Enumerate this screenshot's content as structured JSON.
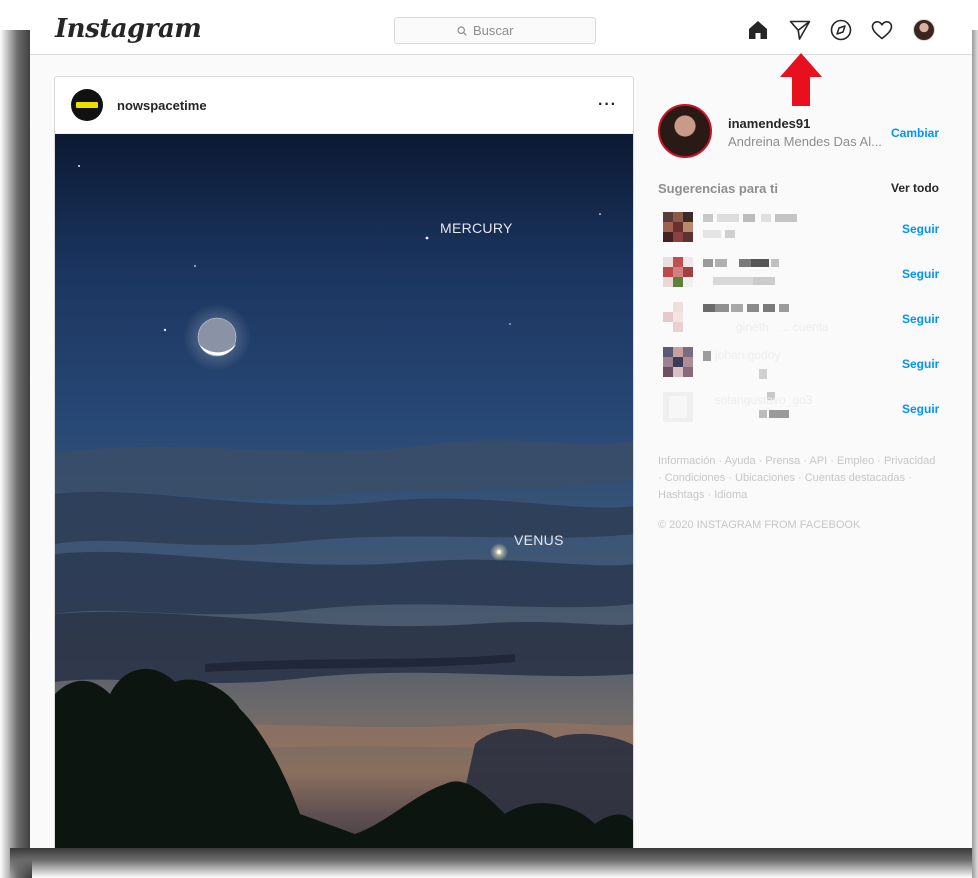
{
  "header": {
    "logo": "Instagram",
    "search_placeholder": "Buscar",
    "icons": [
      "home-icon",
      "direct-message-icon",
      "explore-icon",
      "activity-heart-icon",
      "profile-avatar"
    ]
  },
  "post": {
    "username": "nowspacetime",
    "more_label": "···",
    "photo_labels": {
      "mercury": "MERCURY",
      "venus": "VENUS"
    }
  },
  "sidebar": {
    "username": "inamendes91",
    "full_name": "Andreina Mendes Das Al...",
    "switch_label": "Cambiar",
    "suggestions_title": "Sugerencias para ti",
    "see_all_label": "Ver todo",
    "suggestions": [
      {
        "follow_label": "Seguir",
        "ghost_text": ""
      },
      {
        "follow_label": "Seguir",
        "ghost_text": ""
      },
      {
        "follow_label": "Seguir",
        "ghost_text": "gineth · ... cuenta"
      },
      {
        "follow_label": "Seguir",
        "ghost_text": "johan.godoy"
      },
      {
        "follow_label": "Seguir",
        "ghost_text": "solangustavo_go3"
      }
    ],
    "footer_links": "Información · Ayuda · Prensa · API · Empleo · Privacidad · Condiciones · Ubicaciones · Cuentas destacadas · Hashtags · Idioma",
    "copyright": "© 2020 INSTAGRAM FROM FACEBOOK"
  },
  "colors": {
    "link_blue": "#0095f6",
    "annotation_red": "#e8101e",
    "border": "#dbdbdb"
  }
}
